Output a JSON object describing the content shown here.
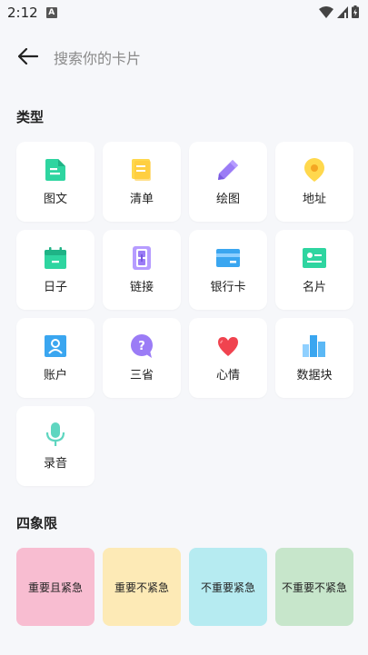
{
  "status_bar": {
    "time": "2:12",
    "notif_letter": "A"
  },
  "search": {
    "placeholder": "搜索你的卡片",
    "value": ""
  },
  "types_section": {
    "title": "类型",
    "items": [
      {
        "label": "图文",
        "icon": "document-icon",
        "color": "#2ed5a0"
      },
      {
        "label": "清单",
        "icon": "checklist-icon",
        "color": "#ffd84d"
      },
      {
        "label": "绘图",
        "icon": "pencil-icon",
        "color": "#9b7cf6"
      },
      {
        "label": "地址",
        "icon": "location-pin-icon",
        "color": "#ffd84d"
      },
      {
        "label": "日子",
        "icon": "calendar-icon",
        "color": "#2ed5a0"
      },
      {
        "label": "链接",
        "icon": "link-icon",
        "color": "#9b7cf6"
      },
      {
        "label": "银行卡",
        "icon": "bank-card-icon",
        "color": "#3aa6f0"
      },
      {
        "label": "名片",
        "icon": "business-card-icon",
        "color": "#2ed5a0"
      },
      {
        "label": "账户",
        "icon": "account-icon",
        "color": "#3aa6f0"
      },
      {
        "label": "三省",
        "icon": "question-bubble-icon",
        "color": "#9b7cf6"
      },
      {
        "label": "心情",
        "icon": "heart-icon",
        "color": "#f0434f"
      },
      {
        "label": "数据块",
        "icon": "bar-chart-icon",
        "color": "#3aa6f0"
      },
      {
        "label": "录音",
        "icon": "microphone-icon",
        "color": "#5fd6c0"
      }
    ]
  },
  "quadrant_section": {
    "title": "四象限",
    "items": [
      {
        "label": "重要且紧急",
        "color": "#f8bdd1"
      },
      {
        "label": "重要不紧急",
        "color": "#fdeab6"
      },
      {
        "label": "不重要紧急",
        "color": "#b6ebf1"
      },
      {
        "label": "不重要不紧急",
        "color": "#c7e6cb"
      }
    ]
  }
}
